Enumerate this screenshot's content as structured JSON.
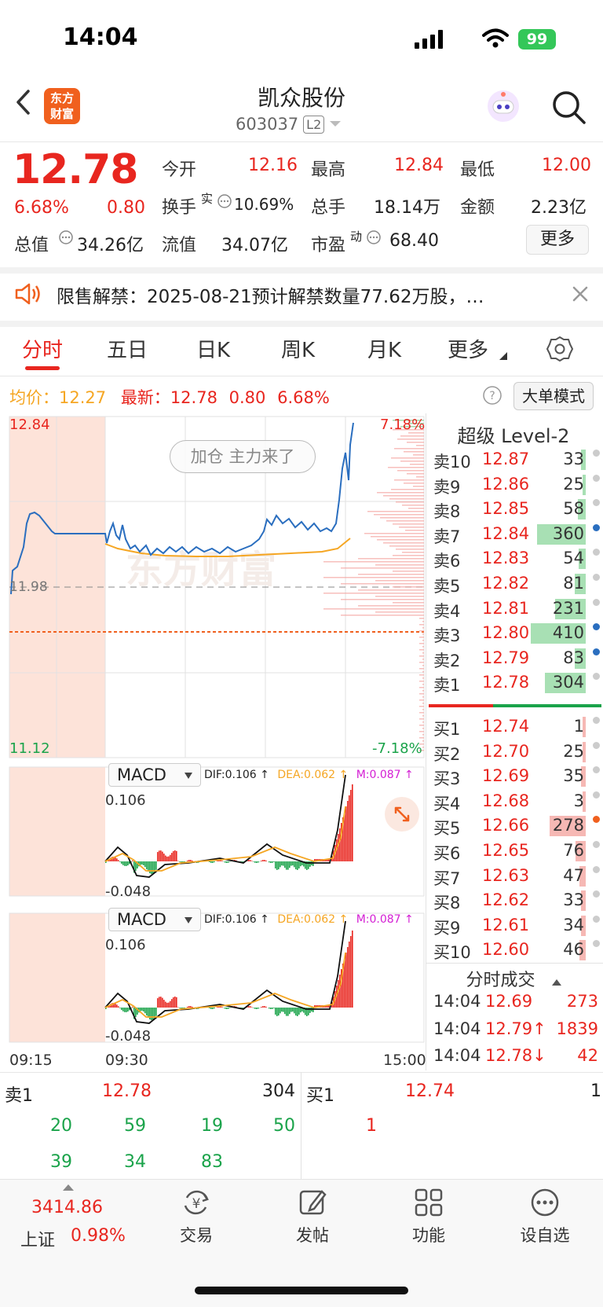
{
  "status_bar": {
    "time": "14:04",
    "battery": "99"
  },
  "header": {
    "logo": "东方\n财富",
    "name": "凯众股份",
    "code": "603037",
    "level": "L2"
  },
  "quote": {
    "price": "12.78",
    "change_pct": "6.68%",
    "change": "0.80",
    "open_label": "今开",
    "open": "12.16",
    "high_label": "最高",
    "high": "12.84",
    "low_label": "最低",
    "low": "12.00",
    "turnover_label": "换手",
    "turnover_sup": "实",
    "turnover": "10.69%",
    "volume_label": "总手",
    "volume": "18.14万",
    "amount_label": "金额",
    "amount": "2.23亿",
    "total_mv_label": "总值",
    "total_mv": "34.26亿",
    "float_mv_label": "流值",
    "float_mv": "34.07亿",
    "pe_label": "市盈",
    "pe_sup": "动",
    "pe": "68.40",
    "more": "更多"
  },
  "notice": {
    "text": "限售解禁：2025-08-21预计解禁数量77.62万股，…"
  },
  "tabs": [
    "分时",
    "五日",
    "日K",
    "周K",
    "月K",
    "更多"
  ],
  "info": {
    "avg_label": "均价：",
    "avg": "12.27",
    "last_label": "最新：",
    "last": "12.78",
    "chg": "0.80",
    "chg_pct": "6.68%",
    "big_order": "大单模式"
  },
  "chart": {
    "top_price": "12.84",
    "bottom_price": "11.12",
    "mid_price": "11.98",
    "top_pct": "7.18%",
    "bottom_pct": "-7.18%",
    "banner": "加仓 主力来了",
    "macd_name": "MACD",
    "dif": "DIF:0.106 ↑",
    "dea": "DEA:0.062 ↑",
    "m": "M:0.087 ↑",
    "macd_top": "0.106",
    "macd_bottom": "-0.048",
    "time_start": "09:15",
    "time_open": "09:30",
    "time_end": "15:00",
    "watermark": "东方财富",
    "colors": {
      "price_line": "#2a6ebf",
      "avg_line": "#f5a623",
      "up": "#e8261f",
      "down": "#1aa34a"
    }
  },
  "level2": {
    "title": "超级 Level-2",
    "asks": [
      {
        "label": "卖10",
        "price": "12.87",
        "vol": "33",
        "dot": "#cccccc",
        "bar": 0.08
      },
      {
        "label": "卖9",
        "price": "12.86",
        "vol": "25",
        "dot": "#cccccc",
        "bar": 0.06
      },
      {
        "label": "卖8",
        "price": "12.85",
        "vol": "58",
        "dot": "#cccccc",
        "bar": 0.14
      },
      {
        "label": "卖7",
        "price": "12.84",
        "vol": "360",
        "dot": "#2a6ebf",
        "bar": 0.88
      },
      {
        "label": "卖6",
        "price": "12.83",
        "vol": "54",
        "dot": "#cccccc",
        "bar": 0.13
      },
      {
        "label": "卖5",
        "price": "12.82",
        "vol": "81",
        "dot": "#cccccc",
        "bar": 0.2
      },
      {
        "label": "卖4",
        "price": "12.81",
        "vol": "231",
        "dot": "#cccccc",
        "bar": 0.56
      },
      {
        "label": "卖3",
        "price": "12.80",
        "vol": "410",
        "dot": "#2a6ebf",
        "bar": 1.0
      },
      {
        "label": "卖2",
        "price": "12.79",
        "vol": "83",
        "dot": "#2a6ebf",
        "bar": 0.2
      },
      {
        "label": "卖1",
        "price": "12.78",
        "vol": "304",
        "dot": "#cccccc",
        "bar": 0.74
      }
    ],
    "bids": [
      {
        "label": "买1",
        "price": "12.74",
        "vol": "1",
        "dot": "#cccccc",
        "bar": 0.01
      },
      {
        "label": "买2",
        "price": "12.70",
        "vol": "25",
        "dot": "#cccccc",
        "bar": 0.06
      },
      {
        "label": "买3",
        "price": "12.69",
        "vol": "35",
        "dot": "#cccccc",
        "bar": 0.08
      },
      {
        "label": "买4",
        "price": "12.68",
        "vol": "3",
        "dot": "#cccccc",
        "bar": 0.01
      },
      {
        "label": "买5",
        "price": "12.66",
        "vol": "278",
        "dot": "#f0601e",
        "bar": 0.66
      },
      {
        "label": "买6",
        "price": "12.65",
        "vol": "76",
        "dot": "#cccccc",
        "bar": 0.18
      },
      {
        "label": "买7",
        "price": "12.63",
        "vol": "47",
        "dot": "#cccccc",
        "bar": 0.11
      },
      {
        "label": "买8",
        "price": "12.62",
        "vol": "33",
        "dot": "#cccccc",
        "bar": 0.08
      },
      {
        "label": "买9",
        "price": "12.61",
        "vol": "34",
        "dot": "#cccccc",
        "bar": 0.08
      },
      {
        "label": "买10",
        "price": "12.60",
        "vol": "46",
        "dot": "#cccccc",
        "bar": 0.11
      }
    ],
    "ticks_title": "分时成交",
    "ticks": [
      {
        "time": "14:04",
        "price": "12.69",
        "vol": "273"
      },
      {
        "time": "14:04",
        "price": "12.79↑",
        "vol": "1839"
      },
      {
        "time": "14:04",
        "price": "12.78↓",
        "vol": "42"
      }
    ]
  },
  "queue": {
    "ask_label": "卖1",
    "ask_price": "12.78",
    "ask_vol": "304",
    "bid_label": "买1",
    "bid_price": "12.74",
    "bid_vol": "1",
    "ask_orders": [
      "20",
      "59",
      "19",
      "50",
      "39",
      "34",
      "83"
    ],
    "bid_orders": [
      "1"
    ]
  },
  "nav": {
    "index_value": "3414.86",
    "index_name": "上证",
    "index_pct": "0.98%",
    "items": [
      "交易",
      "发帖",
      "功能",
      "设自选"
    ]
  }
}
